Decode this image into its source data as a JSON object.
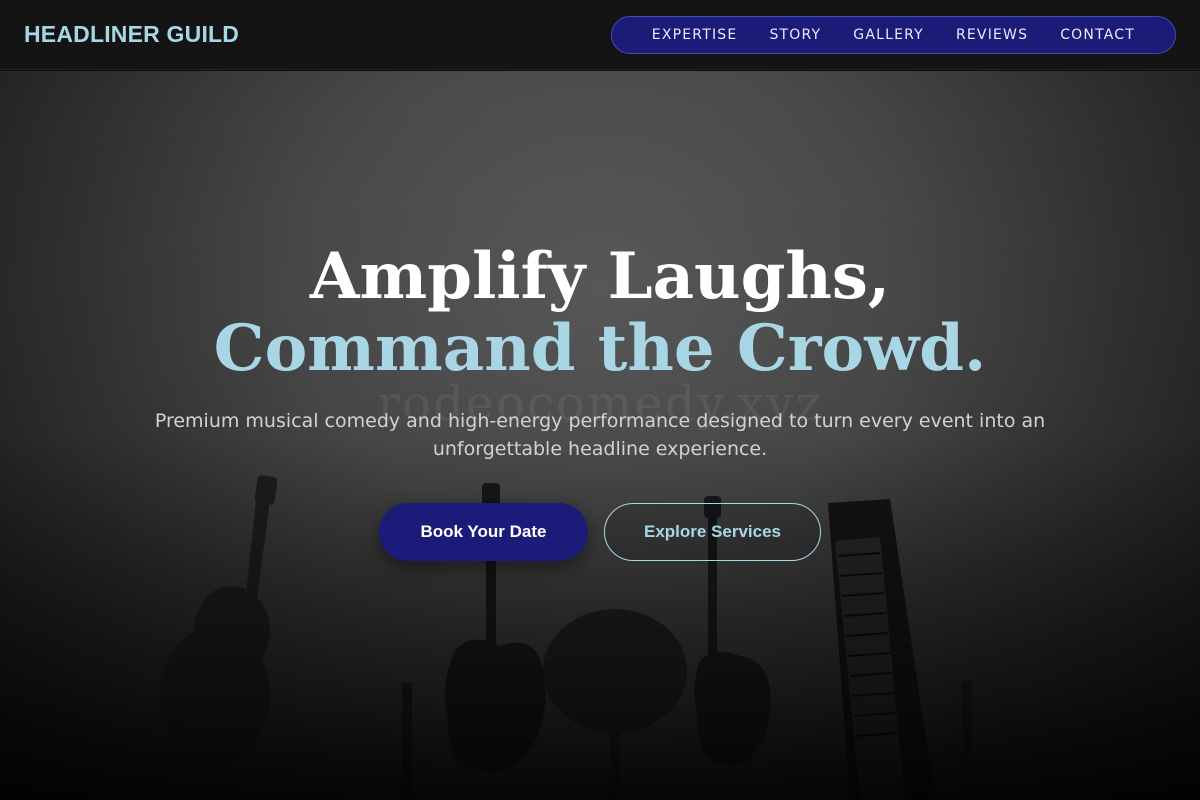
{
  "header": {
    "logo": "HEADLINER GUILD",
    "nav": [
      "EXPERTISE",
      "STORY",
      "GALLERY",
      "REVIEWS",
      "CONTACT"
    ]
  },
  "hero": {
    "headline_line1": "Amplify Laughs,",
    "headline_line2": "Command the Crowd.",
    "subtitle": "Premium musical comedy and high-energy performance designed to turn every event into an unforgettable headline experience.",
    "primary_button": "Book Your Date",
    "secondary_button": "Explore Services",
    "watermark": "rodeocomedy.xyz"
  },
  "colors": {
    "accent": "#a9d6e5",
    "nav_bg": "#1d1b78",
    "primary_button": "#1b1b7a"
  }
}
